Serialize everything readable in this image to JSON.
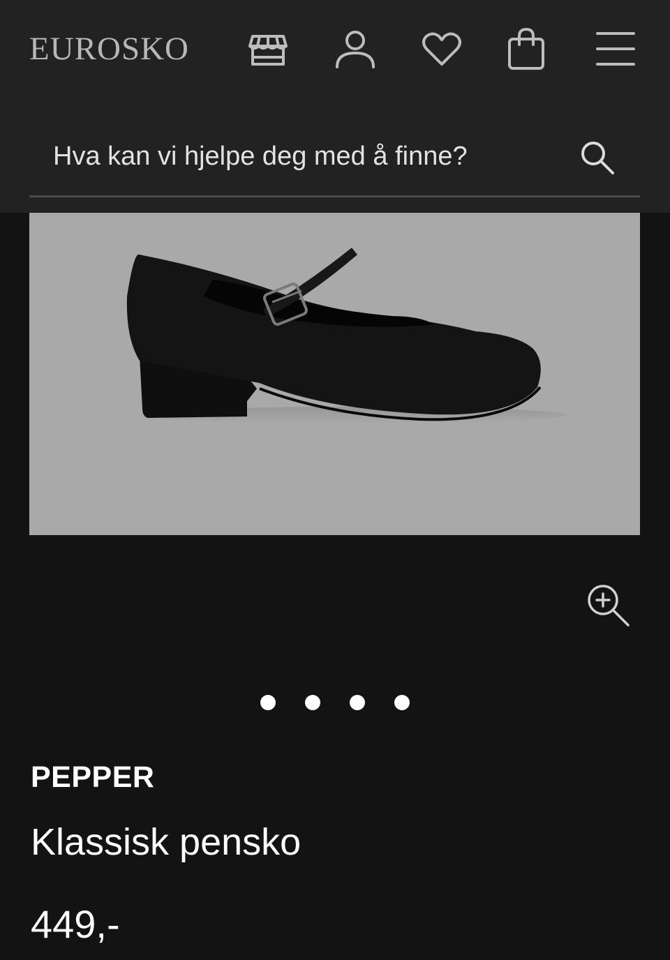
{
  "header": {
    "logo_text": "EUROSKO",
    "icons": [
      "store-icon",
      "account-icon",
      "heart-icon",
      "bag-icon",
      "menu-icon"
    ]
  },
  "search": {
    "placeholder": "Hva kan vi hjelpe deg med å finne?",
    "value": ""
  },
  "gallery": {
    "image_count": 4,
    "active_index": 0,
    "zoom_icon": "zoom-in-icon"
  },
  "product": {
    "brand": "PEPPER",
    "name": "Klassisk pensko",
    "price": "449,-"
  },
  "colors": {
    "header_bg": "#222222",
    "page_bg": "#141313",
    "image_bg": "#a9a9a9",
    "icon_color": "#bdbdbd",
    "text": "#ffffff"
  }
}
